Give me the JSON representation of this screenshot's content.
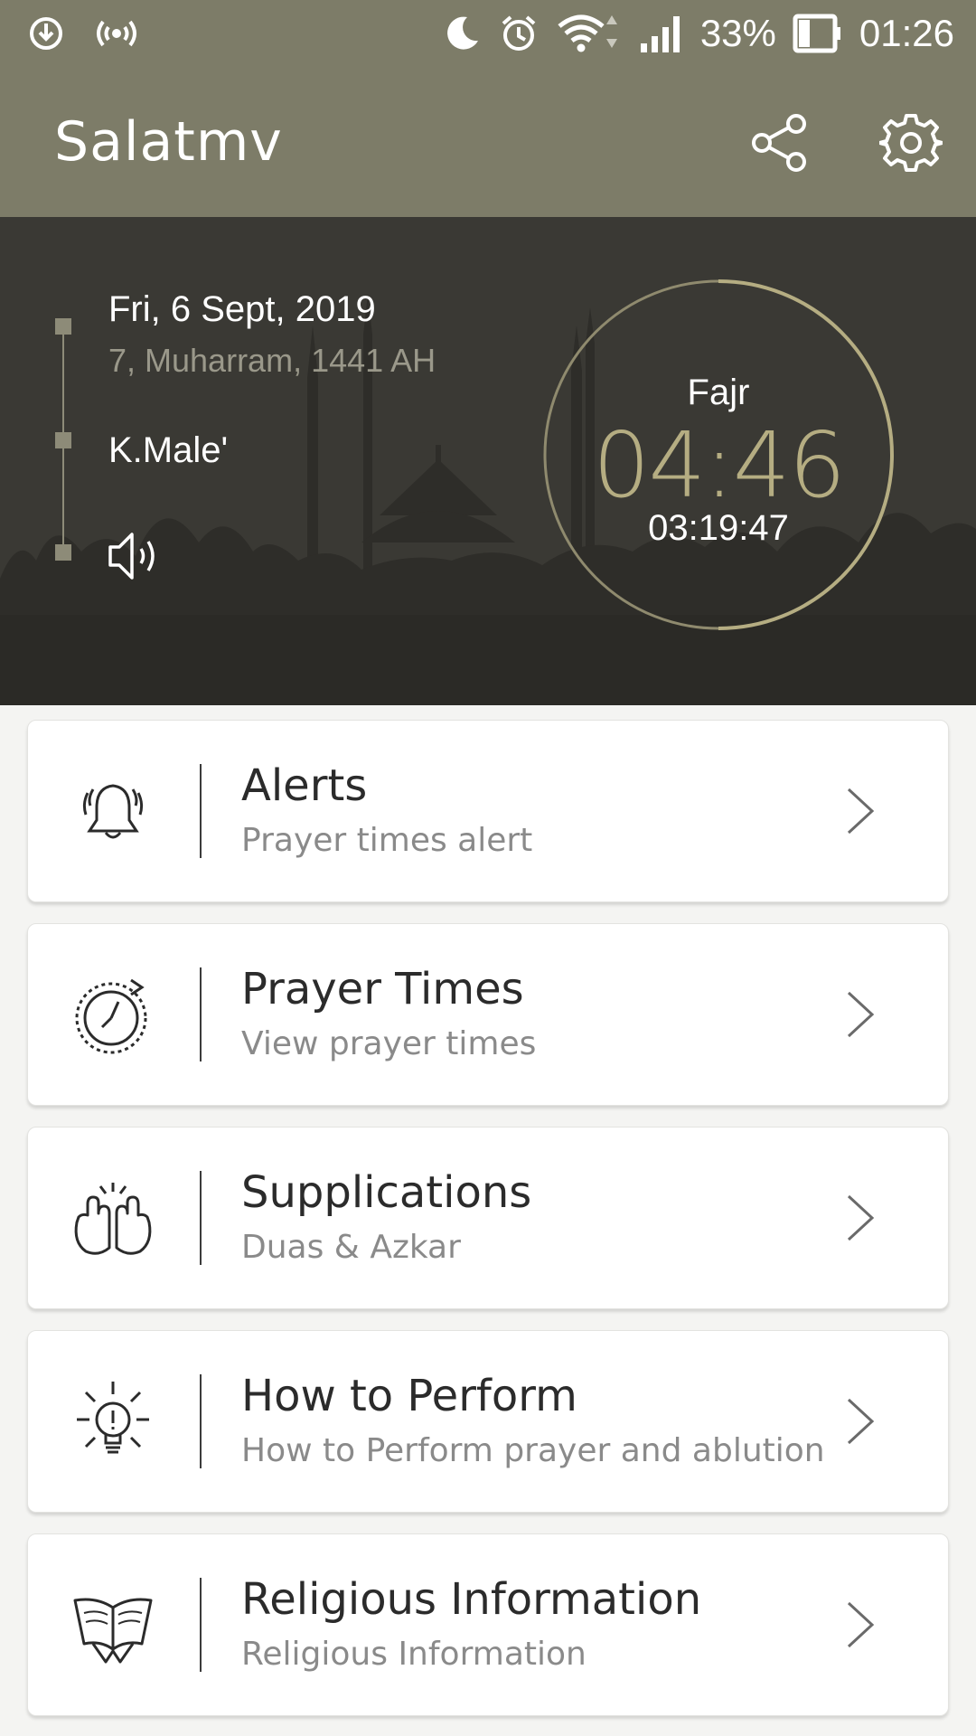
{
  "status_bar": {
    "battery": "33%",
    "time": "01:26",
    "icons": [
      "download-icon",
      "hotspot-icon",
      "moon-icon",
      "alarm-icon",
      "wifi-icon",
      "signal-icon",
      "battery-icon"
    ]
  },
  "app_bar": {
    "title": "Salatmv",
    "background": "#7d7c68",
    "icons": [
      "share-icon",
      "gear-icon"
    ]
  },
  "hero": {
    "date": "Fri, 6 Sept, 2019",
    "hijri_date": "7, Muharram, 1441 AH",
    "location": "K.Male'",
    "sound_icon": "speaker-icon",
    "next_prayer": {
      "name": "Fajr",
      "time": "04:46",
      "countdown": "03:19:47",
      "accent": "#b5ad82"
    }
  },
  "menu": [
    {
      "title": "Alerts",
      "subtitle": "Prayer times alert",
      "icon": "bell-icon"
    },
    {
      "title": "Prayer Times",
      "subtitle": "View prayer times",
      "icon": "clock-icon"
    },
    {
      "title": "Supplications",
      "subtitle": "Duas & Azkar",
      "icon": "praying-hands-icon"
    },
    {
      "title": "How to Perform",
      "subtitle": "How to Perform prayer and ablution",
      "icon": "lightbulb-icon"
    },
    {
      "title": "Religious Information",
      "subtitle": "Religious Information",
      "icon": "quran-book-icon"
    }
  ]
}
